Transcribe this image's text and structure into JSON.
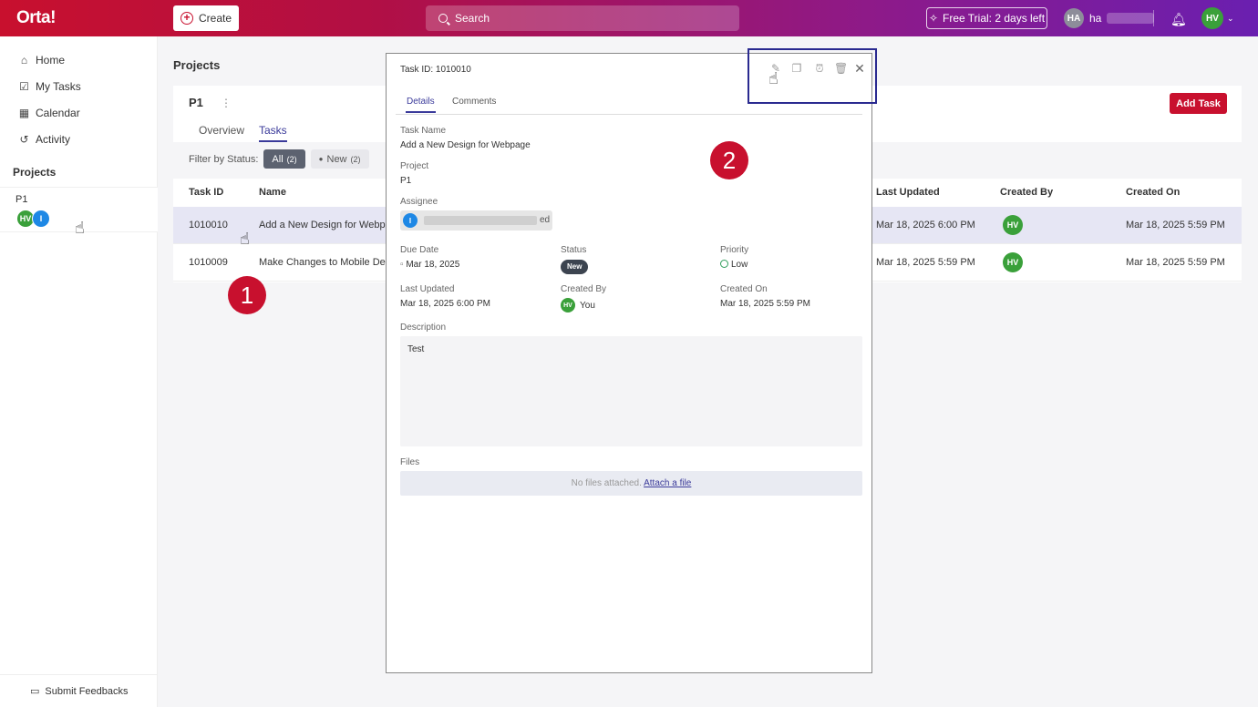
{
  "header": {
    "logo": "Orta!",
    "create_label": "Create",
    "search_placeholder": "Search",
    "trial_label": "Free Trial: 2 days left",
    "user_initials": "HA",
    "user_name_prefix": "ha",
    "me_initials": "HV"
  },
  "sidebar": {
    "items": [
      {
        "label": "Home",
        "icon": "home-icon"
      },
      {
        "label": "My Tasks",
        "icon": "checkbox-icon"
      },
      {
        "label": "Calendar",
        "icon": "calendar-icon"
      },
      {
        "label": "Activity",
        "icon": "history-icon"
      }
    ],
    "section_title": "Projects",
    "project": {
      "name": "P1",
      "members": [
        "HV",
        "I"
      ]
    },
    "feedback_label": "Submit Feedbacks"
  },
  "main": {
    "title": "Projects",
    "project_name": "P1",
    "tabs": [
      "Overview",
      "Tasks"
    ],
    "add_task_label": "Add Task",
    "filter_label": "Filter by Status:",
    "filters": [
      {
        "label": "All",
        "count": "(2)"
      },
      {
        "label": "New",
        "count": "(2)"
      }
    ],
    "table": {
      "headers": [
        "Task ID",
        "Name",
        "Last Updated",
        "Created By",
        "Created On"
      ],
      "rows": [
        {
          "id": "1010010",
          "name": "Add a New Design for Webpag",
          "updated": "Mar 18, 2025 6:00 PM",
          "created_by": "HV",
          "created_on": "Mar 18, 2025 5:59 PM"
        },
        {
          "id": "1010009",
          "name": "Make Changes to Mobile Desi",
          "updated": "Mar 18, 2025 5:59 PM",
          "created_by": "HV",
          "created_on": "Mar 18, 2025 5:59 PM"
        }
      ]
    }
  },
  "modal": {
    "task_id_label": "Task ID:",
    "task_id": "1010010",
    "tabs": [
      "Details",
      "Comments"
    ],
    "task_name_label": "Task Name",
    "task_name": "Add a New Design for Webpage",
    "project_label": "Project",
    "project": "P1",
    "assignee_label": "Assignee",
    "assignee_initial": "I",
    "assignee_tail": "ed",
    "due_date_label": "Due Date",
    "due_date": "Mar 18, 2025",
    "status_label": "Status",
    "status": "New",
    "priority_label": "Priority",
    "priority": "Low",
    "last_updated_label": "Last Updated",
    "last_updated": "Mar 18, 2025 6:00 PM",
    "created_by_label": "Created By",
    "created_by_initials": "HV",
    "created_by": "You",
    "created_on_label": "Created On",
    "created_on": "Mar 18, 2025 5:59 PM",
    "description_label": "Description",
    "description": "Test",
    "files_label": "Files",
    "no_files": "No files attached.",
    "attach_link": "Attach a file"
  },
  "steps": [
    "1",
    "2"
  ],
  "colors": {
    "brand_red": "#c8102e",
    "accent": "#3a3a9a",
    "green": "#3aa03a",
    "blue": "#1e88e5"
  }
}
